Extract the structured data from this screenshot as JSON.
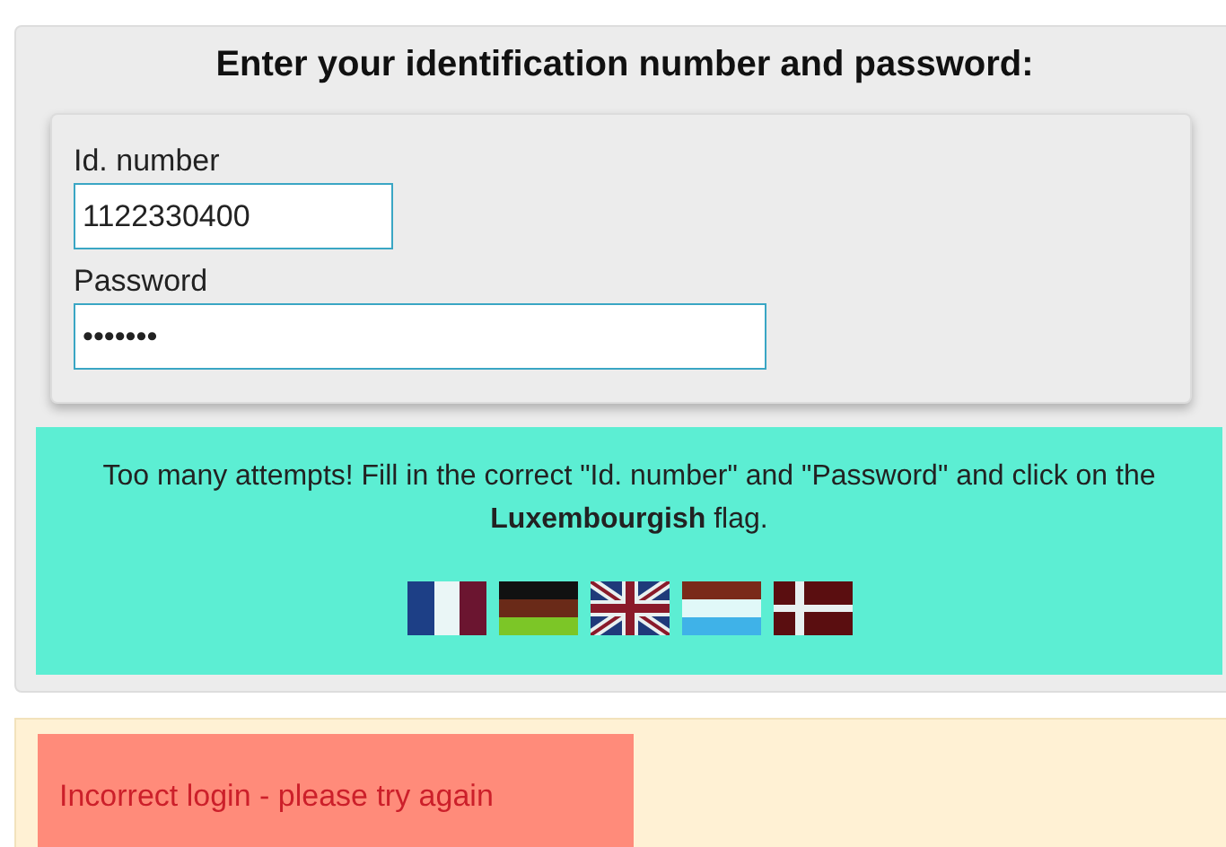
{
  "heading": "Enter your identification number and password:",
  "fields": [
    {
      "label": "Id. number",
      "value": "1122330400",
      "kind": "short"
    },
    {
      "label": "Password",
      "value": "•••••••",
      "kind": "long"
    }
  ],
  "notice": "Too many attempts! Fill in the correct \"Id. number\" and \"Password\" and click on the **Luxembourgish** flag.",
  "flags": [
    {
      "kind": "fr"
    },
    {
      "kind": "de"
    },
    {
      "kind": "gb"
    },
    {
      "kind": "lu"
    },
    {
      "kind": "dk"
    }
  ],
  "error": "Incorrect login - please try again"
}
